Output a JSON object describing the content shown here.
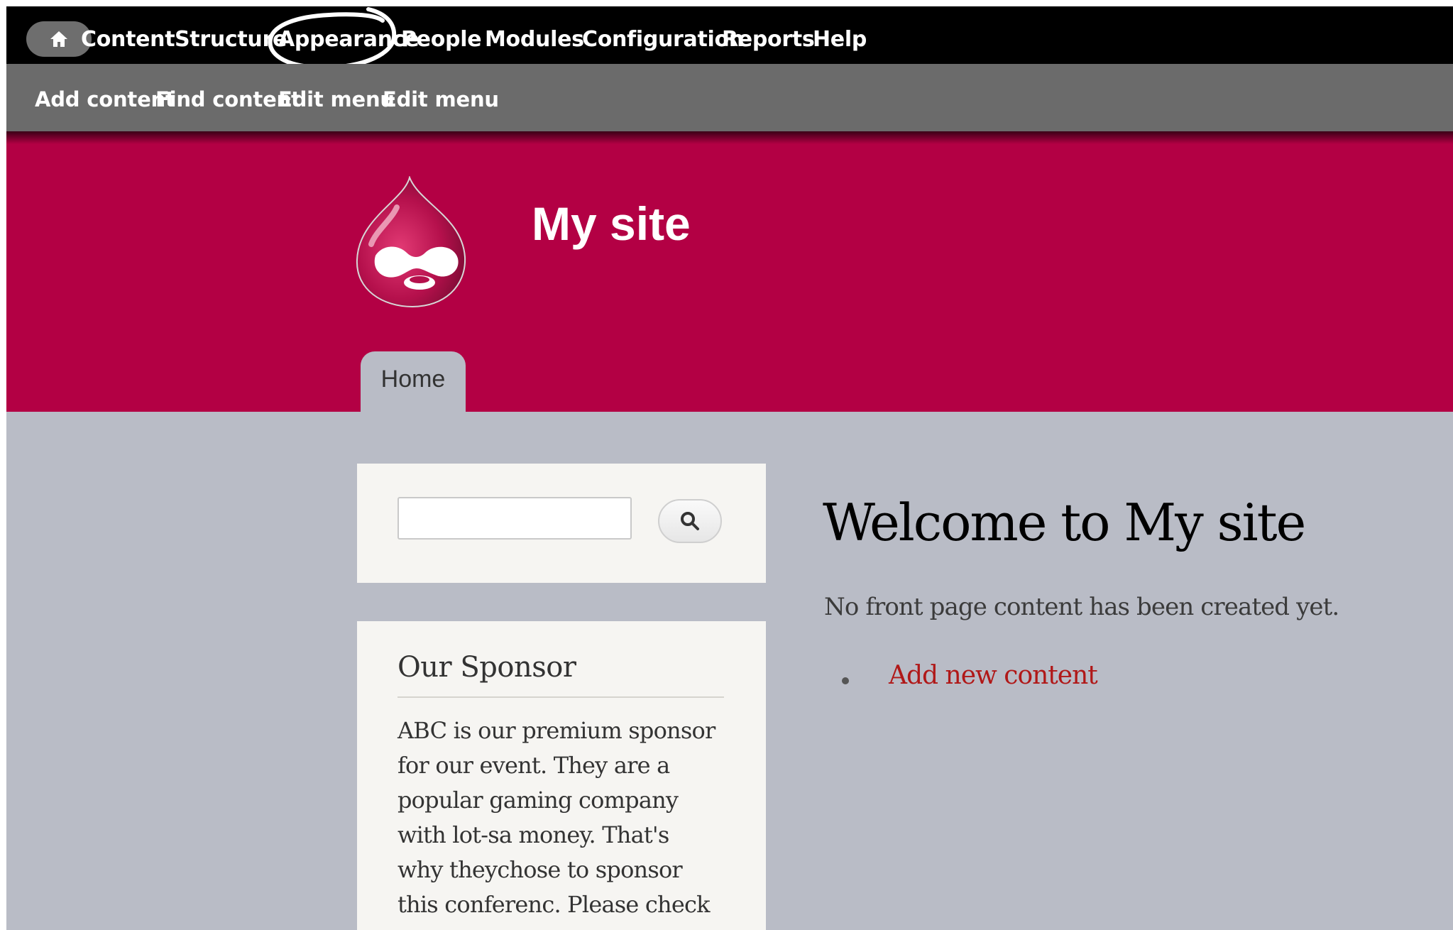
{
  "toolbar": {
    "home_icon": "home-icon",
    "items": [
      "Content",
      "Structure",
      "Appearance",
      "People",
      "Modules",
      "Configuration",
      "Reports",
      "Help"
    ],
    "highlight_color": "#ffffff"
  },
  "shortcuts": {
    "items": [
      "Add content",
      "Find content",
      "Edit menu",
      "Edit menu"
    ]
  },
  "header": {
    "site_name": "My site",
    "logo_icon": "drupal-drop-logo",
    "tab_home": "Home",
    "background_color": "#b30044"
  },
  "search": {
    "value": "",
    "button_icon": "search-icon"
  },
  "sponsor": {
    "title": "Our Sponsor",
    "lines": [
      "ABC is our premium sponsor",
      "for our event. They are a",
      "popular gaming company",
      "with lot-sa money. That's",
      "why theychose to sponsor",
      "this conferenc. Please check"
    ]
  },
  "main": {
    "title": "Welcome to My site",
    "message": "No front page content has been created yet.",
    "add_link": "Add new content",
    "link_color": "#b01818"
  }
}
